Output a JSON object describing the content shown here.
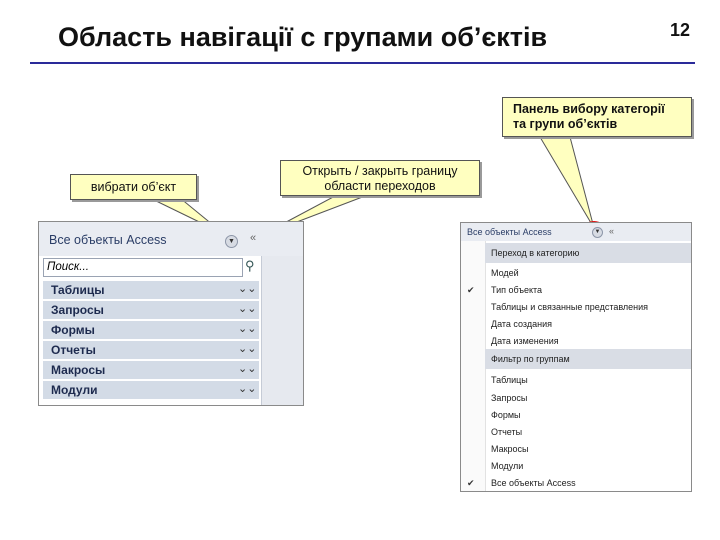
{
  "slide": {
    "title": "Область навігації с групами об’єктів",
    "number": "12"
  },
  "callouts": {
    "pick_object": "вибрати об’єкт",
    "toggle_pane_line1": "Открыть / закрыть границу",
    "toggle_pane_line2": "области переходов",
    "category_panel_line1": "Панель вибору категорії",
    "category_panel_line2": "та групи об’єктів"
  },
  "nav_pane": {
    "title": "Все объекты Access",
    "search_placeholder": "Поиск...",
    "groups": [
      "Таблицы",
      "Запросы",
      "Формы",
      "Отчеты",
      "Макросы",
      "Модули"
    ]
  },
  "menu_pane": {
    "title": "Все объекты Access",
    "category_header": "Переход в категорию",
    "categories": [
      "Модей",
      "Тип объекта",
      "Таблицы и связанные представления",
      "Дата создания",
      "Дата изменения"
    ],
    "filter_header": "Фильтр по группам",
    "filters": [
      "Таблицы",
      "Запросы",
      "Формы",
      "Отчеты",
      "Макросы",
      "Модули",
      "Все объекты Access"
    ]
  },
  "colors": {
    "callout_fill": "#ffffc0",
    "highlight_ring": "#e01010",
    "title_rule": "#2a2a99"
  }
}
